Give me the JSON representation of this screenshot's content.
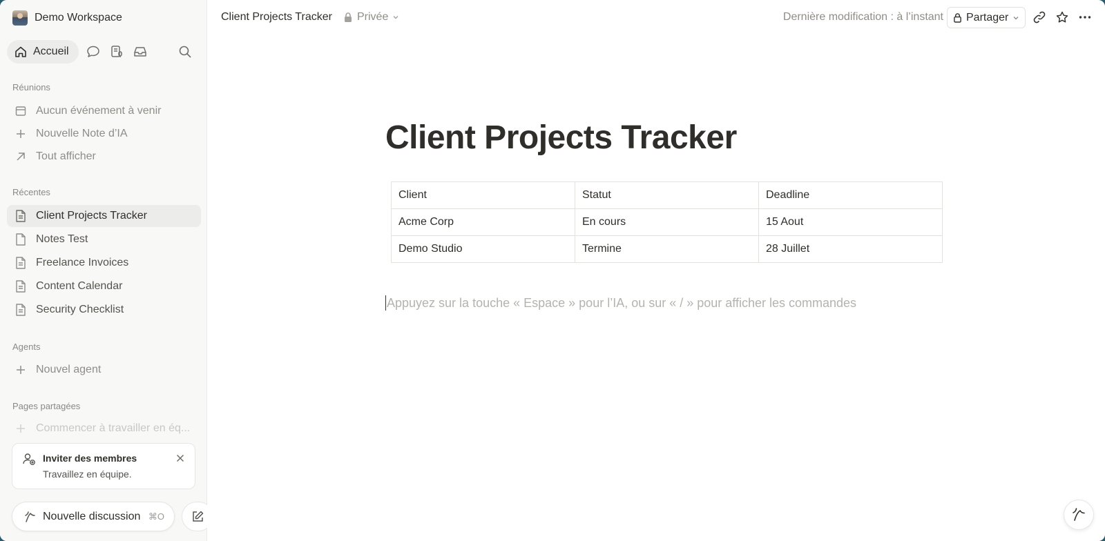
{
  "workspace": {
    "name": "Demo Workspace"
  },
  "nav": {
    "home_label": "Accueil"
  },
  "sidebar": {
    "meetings": {
      "title": "Réunions",
      "items": [
        "Aucun événement à venir",
        "Nouvelle Note d’IA",
        "Tout afficher"
      ]
    },
    "recents": {
      "title": "Récentes",
      "items": [
        "Client Projects Tracker",
        "Notes Test",
        "Freelance Invoices",
        "Content Calendar",
        "Security Checklist"
      ]
    },
    "agents": {
      "title": "Agents",
      "new_agent": "Nouvel agent"
    },
    "shared": {
      "title": "Pages partagées",
      "start": "Commencer à travailler en éq..."
    },
    "invite": {
      "title": "Inviter des membres",
      "subtitle": "Travaillez en équipe."
    },
    "new_chat": {
      "label": "Nouvelle discussion",
      "shortcut": "⌘O"
    }
  },
  "topbar": {
    "title": "Client Projects Tracker",
    "privacy": "Privée",
    "last_edited": "Dernière modification : à l’instant",
    "share_label": "Partager"
  },
  "page": {
    "title": "Client Projects Tracker",
    "table": {
      "rows": [
        [
          "Client",
          "Statut",
          "Deadline"
        ],
        [
          "Acme Corp",
          "En cours",
          "15 Aout"
        ],
        [
          "Demo Studio",
          "Termine",
          "28 Juillet"
        ]
      ]
    },
    "placeholder": "Appuyez sur la touche « Espace » pour l’IA, ou sur « / » pour afficher les commandes"
  }
}
